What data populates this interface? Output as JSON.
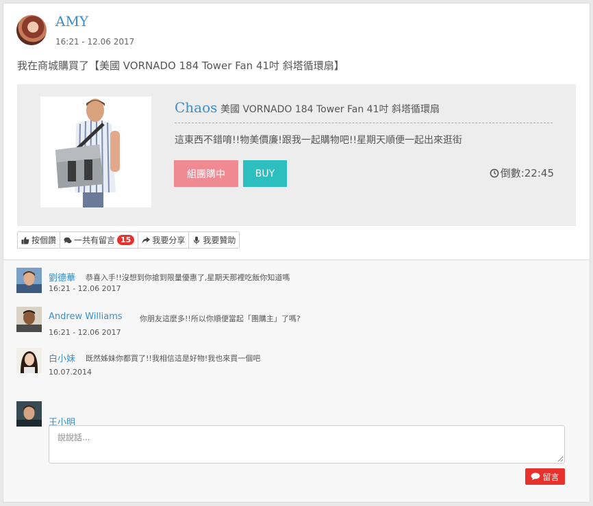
{
  "post": {
    "author": "AMY",
    "time": "16:21 - 12.06   2017",
    "text": "我在商城購買了【美國 VORNADO 184 Tower Fan 41吋 斜塔循環扇】"
  },
  "product": {
    "seller": "Chaos",
    "name": "美國 VORNADO 184 Tower Fan 41吋 斜塔循環扇",
    "description": "這東西不錯唷!!物美價廉!跟我一起購物吧!!星期天順便一起出來逛街",
    "group_buy_label": "組團購中",
    "buy_label": "BUY",
    "countdown": "倒數:22:45"
  },
  "toolbar": {
    "like_label": "按個讚",
    "comments_label": "一共有留言",
    "comments_count": "15",
    "share_label": "我要分享",
    "sponsor_label": "我要贊助"
  },
  "comments": [
    {
      "name": "劉德華",
      "text": "恭喜入手!!沒想到你搶到限量優惠了,星期天那裡吃飯你知道嗎",
      "time": "16:21 - 12.06   2017"
    },
    {
      "name": "Andrew Williams",
      "text": "你朋友這麼多!!所以你順便當起「團購主」了嗎?",
      "time": "16:21 - 12.06   2017"
    },
    {
      "name": "白小妹",
      "text": "既然姊妹你都買了!!我相信這是好物!我也來買一個吧",
      "time": "10.07.2014"
    }
  ],
  "reply": {
    "user": "王小明",
    "placeholder": "說說話...",
    "submit_label": "留言"
  },
  "colors": {
    "link_blue": "#3a8fcf",
    "group_pink": "#ef8a93",
    "buy_teal": "#2dbfbf",
    "badge_red": "#e7312d"
  }
}
